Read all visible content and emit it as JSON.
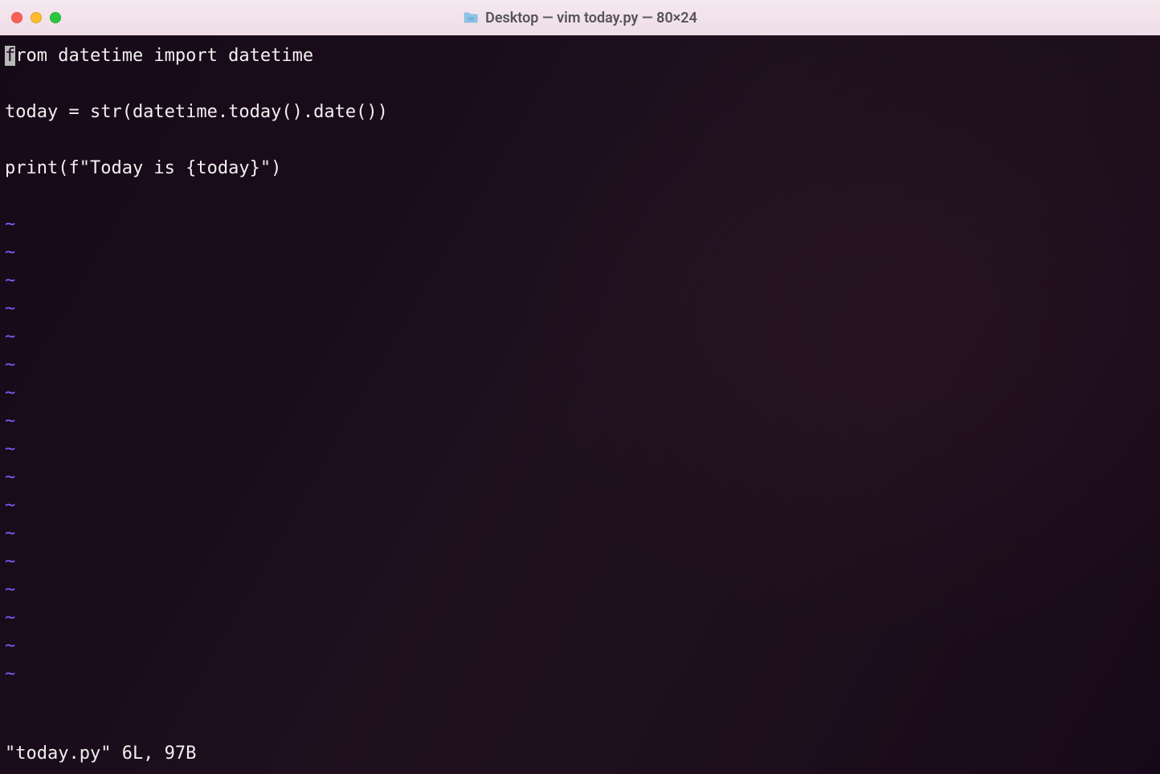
{
  "title_bar": {
    "title": "Desktop — vim today.py — 80×24"
  },
  "editor": {
    "cursor_char": "f",
    "code_lines": [
      {
        "prefix": "",
        "rest": "rom datetime import datetime",
        "has_cursor": true
      },
      {
        "text": ""
      },
      {
        "text": "today = str(datetime.today().date())"
      },
      {
        "text": ""
      },
      {
        "text": "print(f\"Today is {today}\")"
      },
      {
        "text": ""
      }
    ],
    "tilde": "~",
    "tilde_count": 17
  },
  "status": {
    "text": "\"today.py\" 6L, 97B"
  }
}
